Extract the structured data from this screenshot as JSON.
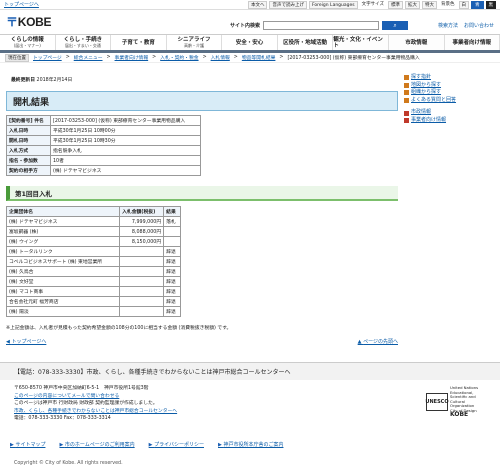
{
  "topbar": {
    "skip_label": "トップページへ",
    "text_label": "本文へ",
    "voice_label": "音声で読み上げ",
    "foreign_label": "Foreign Languages",
    "fontsize_label": "文字サイズ",
    "standard_label": "標準",
    "large_label": "拡大",
    "xlarge_label": "特大",
    "bgcolor_label": "背景色",
    "bg_white": "白",
    "bg_blue": "青",
    "bg_black": "黒"
  },
  "header": {
    "logo_text": "KOBE",
    "search_label": "サイト内検索",
    "search_placeholder": "",
    "search_button": "検索",
    "how_to_search": "検索方法",
    "inquiry": "お問い合わせ"
  },
  "nav": [
    {
      "label": "くらしの情報",
      "sub": "(届出・マナー)"
    },
    {
      "label": "くらし・手続き",
      "sub": "届出・すまい・交通"
    },
    {
      "label": "子育て・教育",
      "sub": ""
    },
    {
      "label": "シニアライフ",
      "sub": "高齢・介護"
    },
    {
      "label": "安全・安心",
      "sub": ""
    },
    {
      "label": "区役所・地域活動",
      "sub": ""
    },
    {
      "label": "観光・文化・イベント",
      "sub": ""
    },
    {
      "label": "市政情報",
      "sub": ""
    },
    {
      "label": "事業者向け情報",
      "sub": ""
    }
  ],
  "breadcrumb": {
    "here_label": "現在位置",
    "items": [
      "トップページ",
      "総合メニュー",
      "事業者向け情報",
      "入札・契約・税金",
      "入札情報",
      "物品等開札結果"
    ],
    "current": "[2017-03253-000] (仮称) 東部療育センター事業用物品購入"
  },
  "updated": {
    "label": "最終更新日",
    "value": "2018年2月14日"
  },
  "page_title": "開札結果",
  "info_table": [
    {
      "key": "[契約番号] 件名",
      "value": "[2017-03253-000] (仮称) 東部療育センター事業用物品購入"
    },
    {
      "key": "入札日時",
      "value": "平成30年1月25日 10時00分"
    },
    {
      "key": "開札日時",
      "value": "平成30年1月25日 10時30分"
    },
    {
      "key": "入札方式",
      "value": "指名競争入札"
    },
    {
      "key": "指名・参加数",
      "value": "10者"
    },
    {
      "key": "契約の相手方",
      "value": "(株) ドテヤマビジネス"
    }
  ],
  "round_title": "第1回目入札",
  "results": {
    "headers": [
      "企業団体名",
      "入札金額(税抜)",
      "結果"
    ],
    "rows": [
      {
        "name": "(株) ドテヤマビジネス",
        "amount": "7,999,000円",
        "result": "落札"
      },
      {
        "name": "富坂鋼器 (株)",
        "amount": "8,088,000円",
        "result": ""
      },
      {
        "name": "(株) ウイング",
        "amount": "8,150,000円",
        "result": ""
      },
      {
        "name": "(株) トータルリンク",
        "amount": "",
        "result": "辞退"
      },
      {
        "name": "コベルコビジネスサポート (株) 東地営業所",
        "amount": "",
        "result": "辞退"
      },
      {
        "name": "(株) 久鳥合",
        "amount": "",
        "result": "辞退"
      },
      {
        "name": "(株) 文好堂",
        "amount": "",
        "result": "辞退"
      },
      {
        "name": "(株) マコト商事",
        "amount": "",
        "result": "辞退"
      },
      {
        "name": "合名会社元町 福芳商店",
        "amount": "",
        "result": "辞退"
      },
      {
        "name": "(株) 陽淡",
        "amount": "",
        "result": "辞退"
      }
    ]
  },
  "note": "※上記金額は、入札者が見積もった契約希望金額の108分の100に相当する金額 (消費税抜き税額) です。",
  "pagenav": {
    "top": "トップページへ",
    "page_top": "ページの先頭へ"
  },
  "side": {
    "items": [
      {
        "label": "探す指針",
        "color": "#d07a1c"
      },
      {
        "label": "地図から探す",
        "color": "#d07a1c"
      },
      {
        "label": "組織から探す",
        "color": "#d07a1c"
      },
      {
        "label": "よくある質問と回答",
        "color": "#d07a1c"
      }
    ],
    "items2": [
      {
        "label": "市政情報",
        "color": "#c0392b"
      },
      {
        "label": "事業者向け情報",
        "color": "#c0392b"
      }
    ]
  },
  "footer": {
    "call": "【電話：078-333-3330】市政、くらし、各種手続きでわからないことは神戸市総合コールセンターへ",
    "addr1": "〒650-8570 神戸市中央区加納町6-5-1　神戸市役所1号館3階",
    "addr2": "このページの内容についてメールで問い合わせる",
    "addr3": "このページは神戸市 行財政局 財政部 契約監理課が作成しました。",
    "addr4": "市政、くらし、各種手続きでわからないことは神戸市総合コールセンターへ",
    "addr5": "電話：078-333-3330 Fax：078-333-3314",
    "unesco_abbr": "UNESCO",
    "unesco_text": "United Nations Educational, Scientific and Cultural Organization",
    "city_of_design": "City of Design",
    "kobe": "KOBE",
    "links": [
      "サイトマップ",
      "市のホームページのご利用案内",
      "プライバシーポリシー",
      "神戸市役所本庁舎のご案内"
    ],
    "copyright": "Copyright © City of Kobe. All rights reserved."
  }
}
